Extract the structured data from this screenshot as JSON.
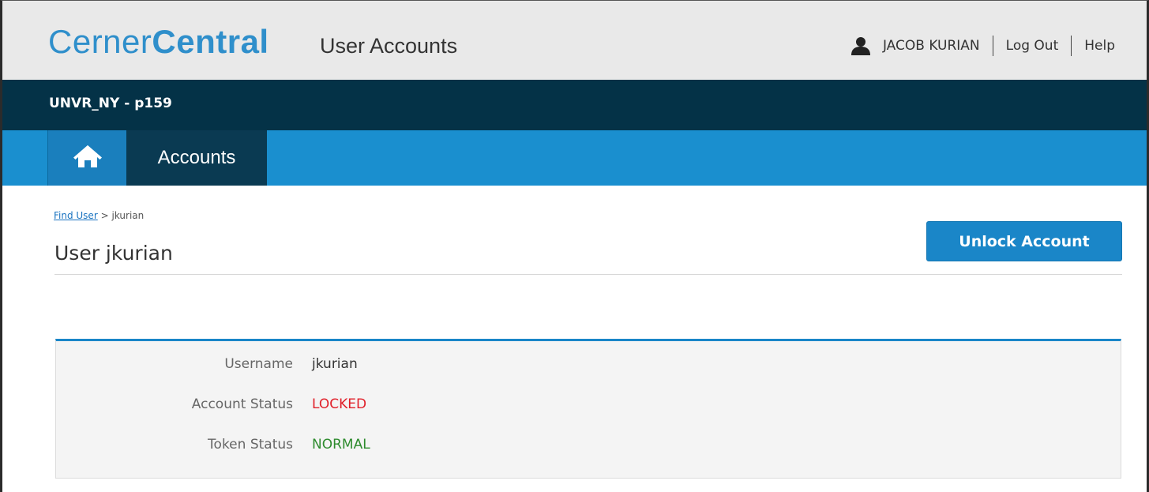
{
  "header": {
    "logo_part1": "Cerner",
    "logo_part2": "Central",
    "app_title": "User Accounts",
    "user_name": "JACOB KURIAN",
    "logout_label": "Log Out",
    "help_label": "Help"
  },
  "org_bar": {
    "org_name": "UNVR_NY - p159"
  },
  "nav": {
    "home_icon": "home-icon",
    "accounts_label": "Accounts"
  },
  "breadcrumb": {
    "link_label": "Find User",
    "separator": ">",
    "current": "jkurian"
  },
  "page": {
    "title": "User jkurian",
    "unlock_button_label": "Unlock Account"
  },
  "details": {
    "rows": [
      {
        "label": "Username",
        "value": "jkurian"
      },
      {
        "label": "Account Status",
        "value": "LOCKED"
      },
      {
        "label": "Token Status",
        "value": "NORMAL"
      }
    ]
  },
  "colors": {
    "brand_blue": "#1a86c8",
    "dark_navy": "#043247",
    "locked_red": "#e0202a",
    "normal_green": "#2e8b2e"
  }
}
